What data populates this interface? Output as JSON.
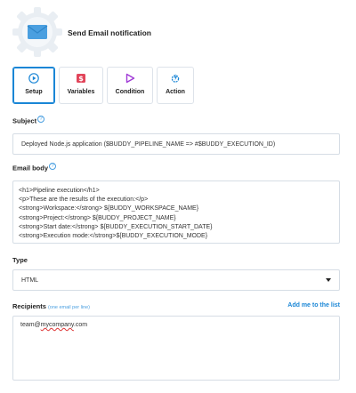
{
  "header": {
    "title": "Send Email notification",
    "icon": "envelope-gear-icon",
    "accent": "#4a9fe0"
  },
  "tabs": [
    {
      "label": "Setup",
      "icon": "play-circle-icon",
      "active": true,
      "color": "#1a86d6"
    },
    {
      "label": "Variables",
      "icon": "dollar-square-icon",
      "active": false,
      "color": "#e2455a"
    },
    {
      "label": "Condition",
      "icon": "play-triangle-icon",
      "active": false,
      "color": "#a03ad6"
    },
    {
      "label": "Action",
      "icon": "gear-bolt-icon",
      "active": false,
      "color": "#1a86d6"
    }
  ],
  "subject": {
    "label": "Subject",
    "help": "?",
    "value": "Deployed Node.js application ($BUDDY_PIPELINE_NAME => #$BUDDY_EXECUTION_ID)"
  },
  "email_body": {
    "label": "Email body",
    "help": "?",
    "lines": [
      "<h1>Pipeline execution</h1>",
      "<p>These are the results of the execution:</p>",
      "<strong>Workspace:</strong> ${BUDDY_WORKSPACE_NAME}",
      "<strong>Project:</strong> ${BUDDY_PROJECT_NAME}",
      "<strong>Start date:</strong> ${BUDDY_EXECUTION_START_DATE}",
      "<strong>Execution mode:</strong>${BUDDY_EXECUTION_MODE}"
    ]
  },
  "type": {
    "label": "Type",
    "selected": "HTML"
  },
  "recipients": {
    "label": "Recipients",
    "hint": "(one email per line)",
    "add_link": "Add me to the list",
    "value_prefix": "team@",
    "value_misspelled": "mycompany",
    "value_suffix": ".com"
  }
}
